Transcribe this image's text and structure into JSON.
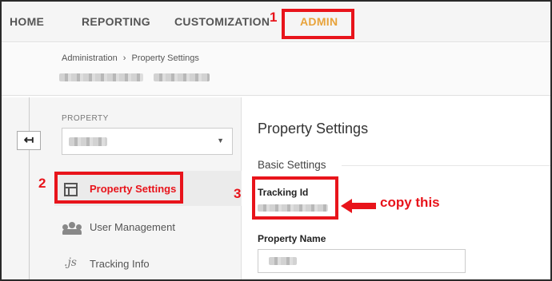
{
  "nav": {
    "home": "HOME",
    "reporting": "REPORTING",
    "customization": "CUSTOMIZATION",
    "admin": "ADMIN",
    "admin_color": "#e8a33a"
  },
  "annotations": {
    "step1": "1",
    "step2": "2",
    "step3": "3",
    "copy_hint": "copy this",
    "annotation_color": "#e8141b"
  },
  "breadcrumb": {
    "root": "Administration",
    "separator": "›",
    "current": "Property Settings"
  },
  "sidebar": {
    "back_icon": "back-arrow-icon",
    "property_label": "PROPERTY",
    "items": [
      {
        "label": "Property Settings",
        "icon": "layout-icon",
        "active": true
      },
      {
        "label": "User Management",
        "icon": "people-icon",
        "active": false
      },
      {
        "label": "Tracking Info",
        "icon": "js-icon",
        "active": false
      }
    ]
  },
  "main": {
    "title": "Property Settings",
    "section": "Basic Settings",
    "tracking_id_label": "Tracking Id",
    "property_name_label": "Property Name"
  }
}
